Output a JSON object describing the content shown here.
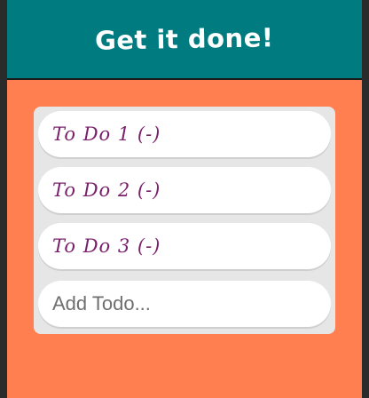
{
  "header": {
    "title": "Get it done!"
  },
  "todos": [
    {
      "label": "To Do 1 (-)"
    },
    {
      "label": "To Do 2 (-)"
    },
    {
      "label": "To Do 3 (-)"
    }
  ],
  "add_todo": {
    "placeholder": "Add Todo...",
    "value": ""
  },
  "colors": {
    "header_bg": "#007c80",
    "app_bg": "#ff7f50",
    "panel_bg": "#e6e6e6",
    "item_bg": "#ffffff",
    "todo_text": "#7a1f6b",
    "title_text": "#ffffff"
  }
}
